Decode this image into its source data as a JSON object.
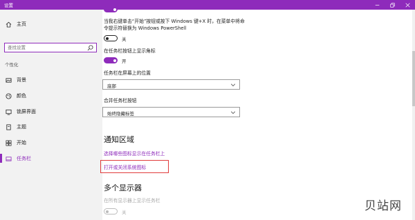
{
  "window": {
    "title": "设置"
  },
  "sidebar": {
    "home": "主页",
    "search_placeholder": "查找设置",
    "group": "个性化",
    "items": [
      {
        "label": "背景",
        "icon": "image-icon"
      },
      {
        "label": "颜色",
        "icon": "palette-icon"
      },
      {
        "label": "锁屏界面",
        "icon": "lock-screen-icon"
      },
      {
        "label": "主题",
        "icon": "theme-icon"
      },
      {
        "label": "开始",
        "icon": "start-icon"
      },
      {
        "label": "任务栏",
        "icon": "taskbar-icon",
        "active": true
      }
    ]
  },
  "main": {
    "powershell_text_line1": "当我右键单击“开始”按钮或按下 Windows 键+X 时，在菜单中将命",
    "powershell_text_line2": "令提示符替换为 Windows PowerShell",
    "powershell_toggle": {
      "state": "关",
      "on": false
    },
    "badge_label": "在任务栏按钮上显示角标",
    "badge_toggle": {
      "state": "开",
      "on": true
    },
    "position_label": "任务栏在屏幕上的位置",
    "position_value": "底部",
    "combine_label": "合并任务栏按钮",
    "combine_value": "始终隐藏标签",
    "notify_heading": "通知区域",
    "notify_link1": "选择哪些图标显示在任务栏上",
    "notify_link2": "打开或关闭系统图标",
    "multi_heading": "多个显示器",
    "multi_label": "在所有显示器上显示任务栏",
    "multi_toggle": {
      "state": "关",
      "on": false
    }
  },
  "watermark": "贝站网",
  "colors": {
    "accent": "#8e2bbb",
    "highlight_box": "#e03a3a"
  }
}
